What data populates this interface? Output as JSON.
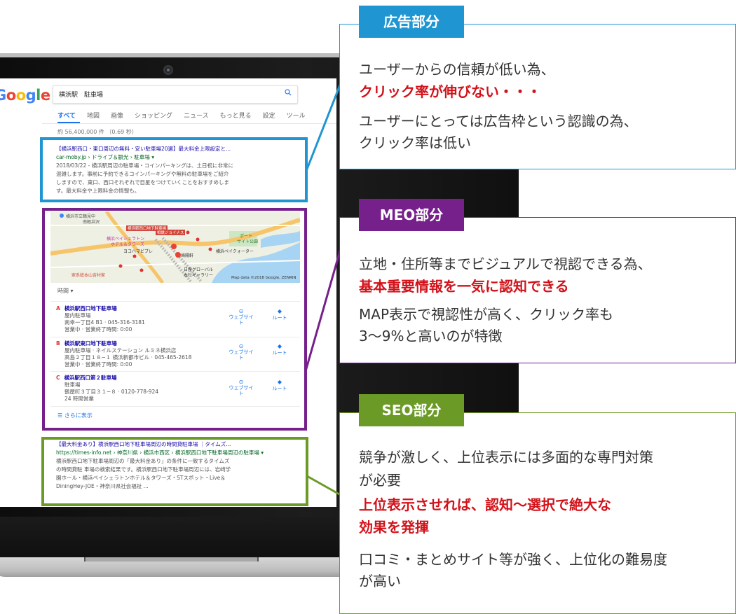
{
  "google": {
    "logo_letters": [
      "G",
      "o",
      "o",
      "g",
      "l",
      "e"
    ],
    "logo_colors": [
      "#4285f4",
      "#ea4335",
      "#fbbc05",
      "#4285f4",
      "#34a853",
      "#ea4335"
    ],
    "query": "横浜駅　駐車場",
    "tabs": [
      "すべて",
      "地図",
      "画像",
      "ショッピング",
      "ニュース",
      "もっと見る",
      "設定",
      "ツール"
    ],
    "result_count": "約 56,400,000 件 （0.69 秒）"
  },
  "ad_result": {
    "title": "【横浜駅西口・東口周辺の無料・安い駐車場20選】最大料金上限設定と...",
    "url": "car-moby.jp › ドライブ＆観光 › 駐車場 ▾",
    "desc": [
      "2018/03/22 - 横浜駅周辺の駐車場・コインパーキングは、土日祝に非常に",
      "混雑します。事前に予約できるコインパーキングや無料の駐車場をご紹介",
      "しますので、東口、西口それぞれで目星をつけていくことをおすすめしま",
      "す。最大料金や上限料金の情報も。"
    ]
  },
  "map": {
    "labels": [
      "横浜市立鶴見中",
      "南軽井沢",
      "横浜駅西口地下駐車場",
      "横浜ベイシェラトン",
      "ホテル＆タワーズ",
      "横浜ベイクォーター",
      "ヨコハマビブレ",
      "ポート",
      "サイト公園",
      "相鉄ジョイナス",
      "崎陽軒",
      "日産グローバル",
      "本社ギャラリー",
      "家系総本山吉村家",
      "Map data ©2018 Google, ZENRIN"
    ],
    "hours_label": "時間 ▾"
  },
  "local_results": [
    {
      "letter": "A",
      "name": "横浜駅西口地下駐車場",
      "lines": [
        "屋内駐車場",
        "南幸一丁目4 B1 · 045-316-3181",
        "営業中 · 営業終了時間: 0:00"
      ]
    },
    {
      "letter": "B",
      "name": "横浜駅東口地下駐車場",
      "lines": [
        "屋内駐車場 · ネイルステーション ルミネ横浜店",
        "高島２丁目１８−１ 横浜新都市ビル · 045-465-2618",
        "営業中 · 営業終了時間: 0:00"
      ]
    },
    {
      "letter": "C",
      "name": "横浜駅西口第２駐車場",
      "lines": [
        "駐車場",
        "鶴屋町３丁目３１−８ · 0120-778-924",
        "24 時間営業"
      ]
    }
  ],
  "local_actions": {
    "website": "ウェブサイト",
    "route": "ルート"
  },
  "more_link": "さらに表示",
  "organic_result": {
    "title": "【最大料金あり】横浜駅西口地下駐車場周辺の時間貸駐車場 ｜タイムズ...",
    "url": "https://times-info.net › 神奈川県 › 横浜市西区 › 横浜駅西口地下駐車場周辺の駐車場 ▾",
    "desc": [
      "横浜駅西口地下駐車場周辺の「最大料金あり」の条件に一致するタイムズ",
      "の時間貸駐 車場の検索結果です。横浜駅西口地下駐車場周辺には、岩崎学",
      "園ホール・横浜ベイシェラトンホテル＆タワーズ・STスポット・Live＆",
      "DiningHey-JOE・神奈川県社会福祉 ..."
    ]
  },
  "callouts": {
    "ad": {
      "label": "広告部分",
      "line1": "ユーザーからの信頼が低い為、",
      "highlight": "クリック率が伸びない・・・",
      "line2": "ユーザーにとっては広告枠という認識の為、",
      "line3": "クリック率は低い"
    },
    "meo": {
      "label": "MEO部分",
      "line1": "立地・住所等までビジュアルで視認できる為、",
      "highlight": "基本重要情報を一気に認知できる",
      "line2": "MAP表示で視認性が高く、クリック率も",
      "line3": "3〜9%と高いのが特徴"
    },
    "seo": {
      "label": "SEO部分",
      "line1": "競争が激しく、上位表示には多面的な専門対策",
      "line2": "が必要",
      "highlight1": "上位表示させれば、認知〜選択で絶大な",
      "highlight2": "効果を発揮",
      "line3": "口コミ・まとめサイト等が強く、上位化の難易度",
      "line4": "が高い"
    }
  },
  "colors": {
    "ad": "#1f95d2",
    "meo": "#75208b",
    "seo": "#6b9a26",
    "highlight": "#d2121a"
  }
}
